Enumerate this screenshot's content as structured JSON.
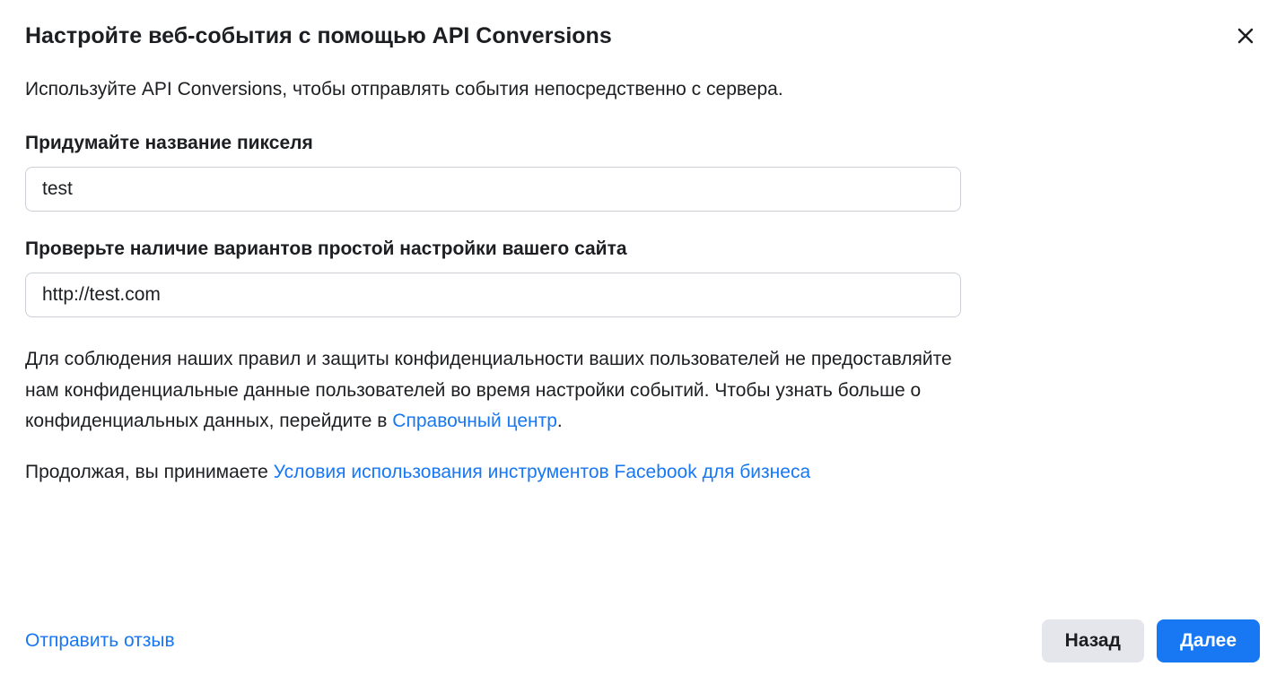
{
  "dialog": {
    "title": "Настройте веб-события с помощью API Conversions",
    "description": "Используйте API Conversions, чтобы отправлять события непосредственно с сервера."
  },
  "fields": {
    "pixel_name": {
      "label": "Придумайте название пикселя",
      "value": "test"
    },
    "site_url": {
      "label": "Проверьте наличие вариантов простой настройки вашего сайта",
      "value": "http://test.com"
    }
  },
  "info": {
    "privacy_text_1": "Для соблюдения наших правил и защиты конфиденциальности ваших пользователей не предоставляйте нам конфиденциальные данные пользователей во время настройки событий. Чтобы узнать больше о конфиденциальных данных, перейдите в ",
    "help_center_link": "Справочный центр",
    "period": ".",
    "continue_text": "Продолжая, вы принимаете ",
    "terms_link": "Условия использования инструментов Facebook для бизнеса"
  },
  "footer": {
    "feedback": "Отправить отзыв",
    "back_button": "Назад",
    "next_button": "Далее"
  }
}
